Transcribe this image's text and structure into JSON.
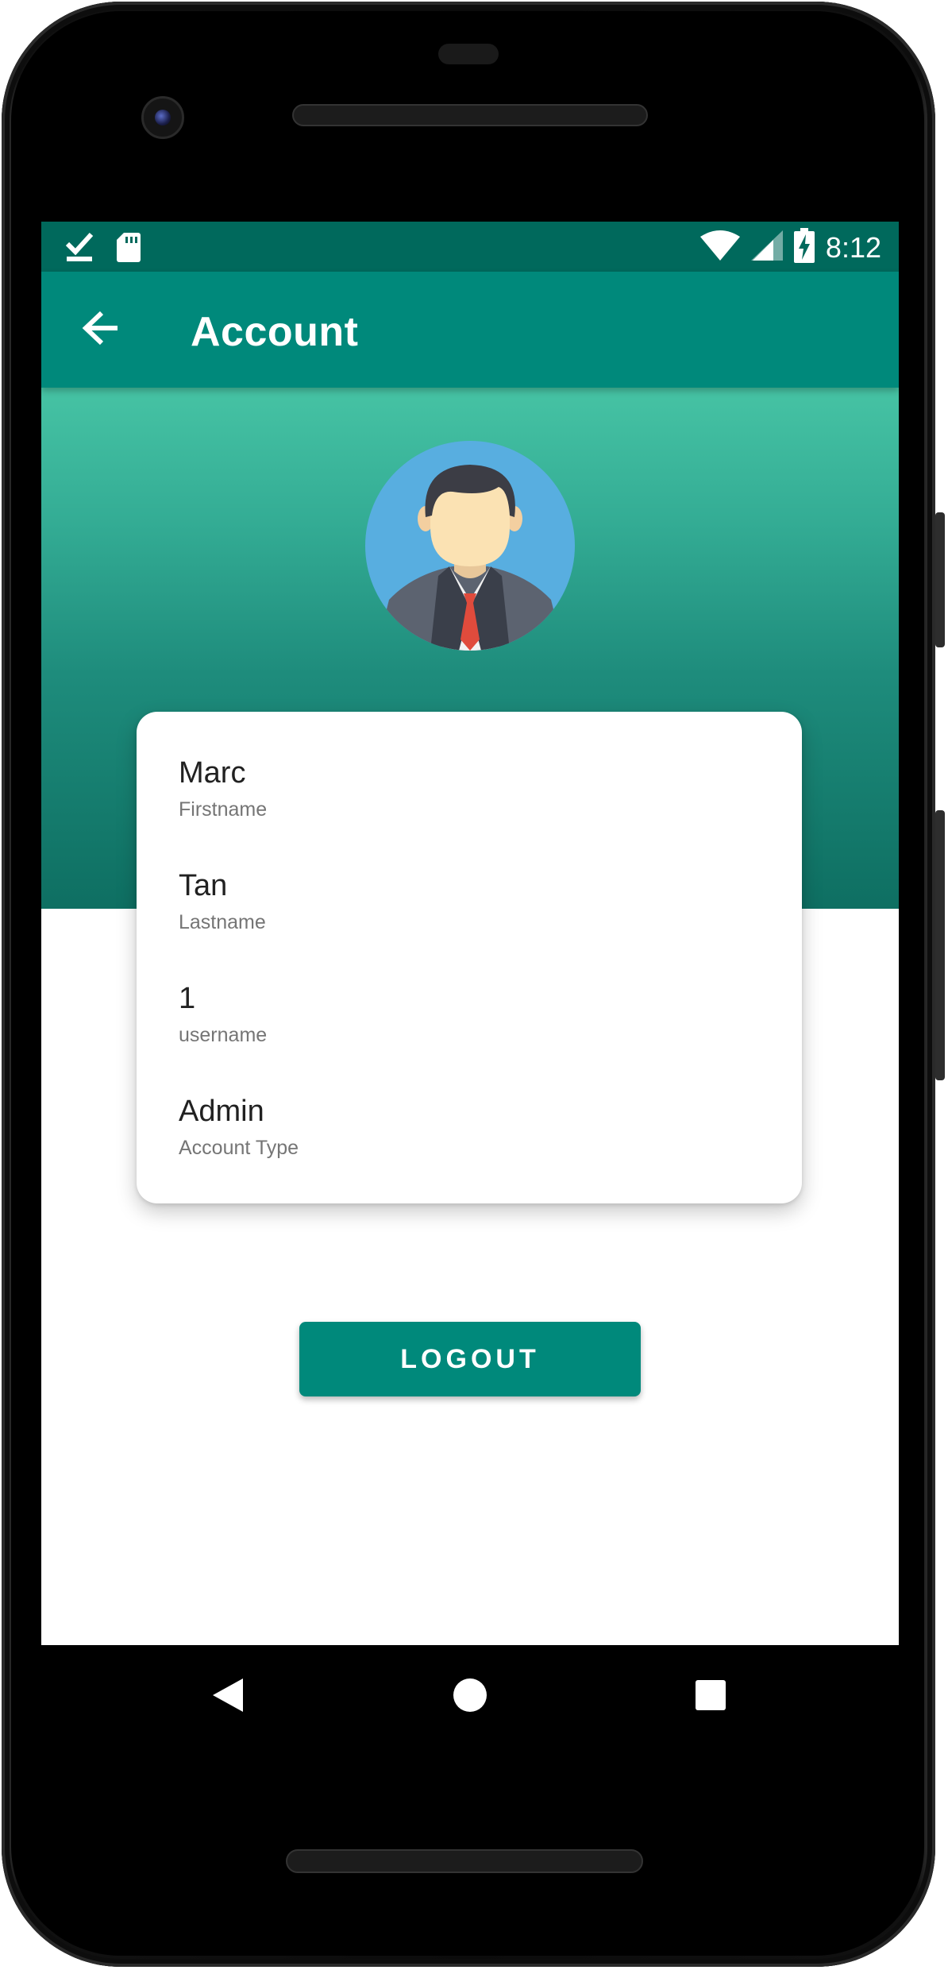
{
  "status_bar": {
    "time": "8:12",
    "left_icons": [
      "check-download-icon",
      "sd-card-icon"
    ],
    "right_icons": [
      "wifi-icon",
      "signal-icon",
      "battery-charging-icon"
    ]
  },
  "app_bar": {
    "title": "Account",
    "back_icon": "arrow-back-icon"
  },
  "profile": {
    "avatar_icon": "businessman-avatar-icon",
    "fields": [
      {
        "value": "Marc",
        "label": "Firstname"
      },
      {
        "value": "Tan",
        "label": "Lastname"
      },
      {
        "value": "1",
        "label": "username"
      },
      {
        "value": "Admin",
        "label": "Account Type"
      }
    ]
  },
  "actions": {
    "logout_label": "LOGOUT"
  },
  "nav_bar": {
    "icons": [
      "nav-back-icon",
      "nav-home-icon",
      "nav-recents-icon"
    ]
  },
  "colors": {
    "primary": "#00897b",
    "primary_dark": "#00695c",
    "header_gradient_top": "#46c3a4",
    "header_gradient_bottom": "#0e6f62",
    "avatar_bg": "#58aee0"
  }
}
